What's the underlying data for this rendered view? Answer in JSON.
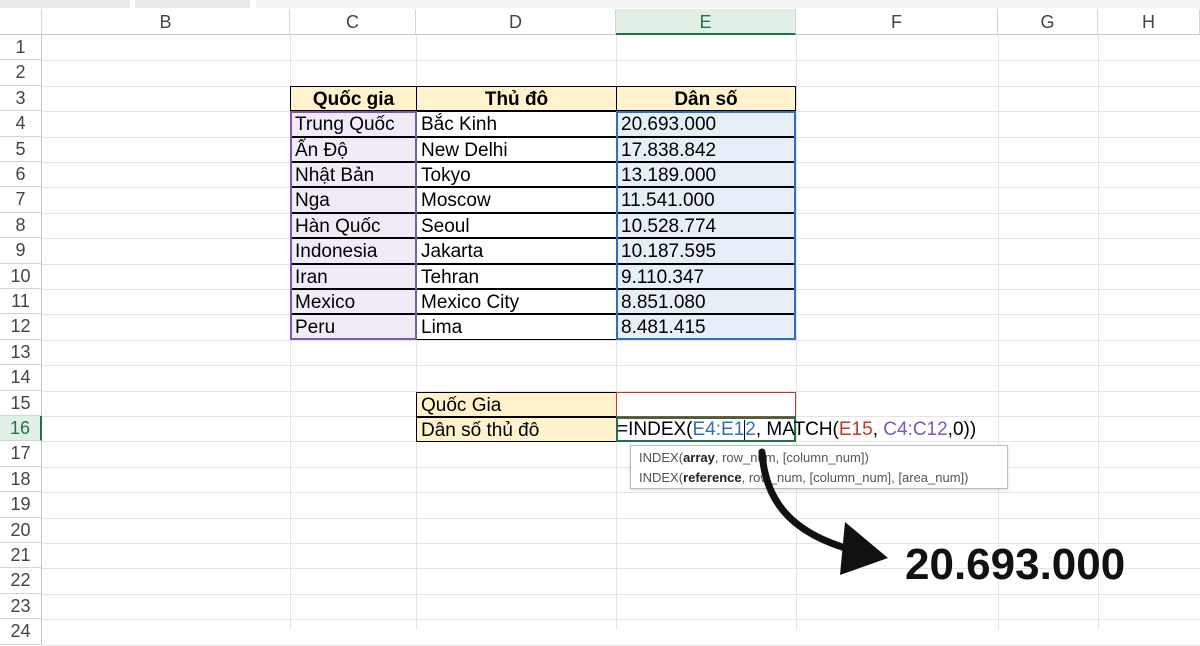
{
  "columns": [
    "B",
    "C",
    "D",
    "E",
    "F",
    "G",
    "H"
  ],
  "active_column": "E",
  "rows": [
    "1",
    "2",
    "3",
    "4",
    "5",
    "6",
    "7",
    "8",
    "9",
    "10",
    "11",
    "12",
    "13",
    "14",
    "15",
    "16",
    "17",
    "18",
    "19",
    "20",
    "21",
    "22",
    "23",
    "24"
  ],
  "active_row": "16",
  "table": {
    "headers": [
      "Quốc gia",
      "Thủ đô",
      "Dân số"
    ],
    "rows": [
      {
        "country": "Trung Quốc",
        "capital": "Bắc Kinh",
        "population": "20.693.000"
      },
      {
        "country": "Ấn Độ",
        "capital": "New Delhi",
        "population": "17.838.842"
      },
      {
        "country": "Nhật Bản",
        "capital": "Tokyo",
        "population": "13.189.000"
      },
      {
        "country": "Nga",
        "capital": "Moscow",
        "population": "11.541.000"
      },
      {
        "country": "Hàn Quốc",
        "capital": "Seoul",
        "population": "10.528.774"
      },
      {
        "country": "Indonesia",
        "capital": "Jakarta",
        "population": "10.187.595"
      },
      {
        "country": "Iran",
        "capital": "Tehran",
        "population": "9.110.347"
      },
      {
        "country": "Mexico",
        "capital": "Mexico City",
        "population": "8.851.080"
      },
      {
        "country": "Peru",
        "capital": "Lima",
        "population": "8.481.415"
      }
    ]
  },
  "lookup": {
    "label1": "Quốc Gia",
    "label2": "Dân số thủ đô",
    "value1": ""
  },
  "formula": {
    "p1": "=INDEX(",
    "p2": "E4:E1",
    "p3": "2",
    "p4": ", MATCH(",
    "p5": "E15",
    "p6": ", ",
    "p7": "C4:C12",
    "p8": ",0))"
  },
  "tooltip": {
    "line1_pre": "INDEX(",
    "line1_bold": "array",
    "line1_post": ", row_num, [column_num])",
    "line2_pre": "INDEX(",
    "line2_bold": "reference",
    "line2_post": ", row_num, [column_num], [area_num])"
  },
  "result": "20.693.000",
  "colors": {
    "header_fill": "#fff2cc",
    "country_fill": "#f0ebf7",
    "population_fill": "#e6eef8",
    "ref_blue": "#2e6fc0",
    "ref_red": "#c0392b",
    "ref_purple": "#8155b8",
    "active_green": "#217346"
  },
  "icons": [
    "curved-arrow-icon"
  ]
}
